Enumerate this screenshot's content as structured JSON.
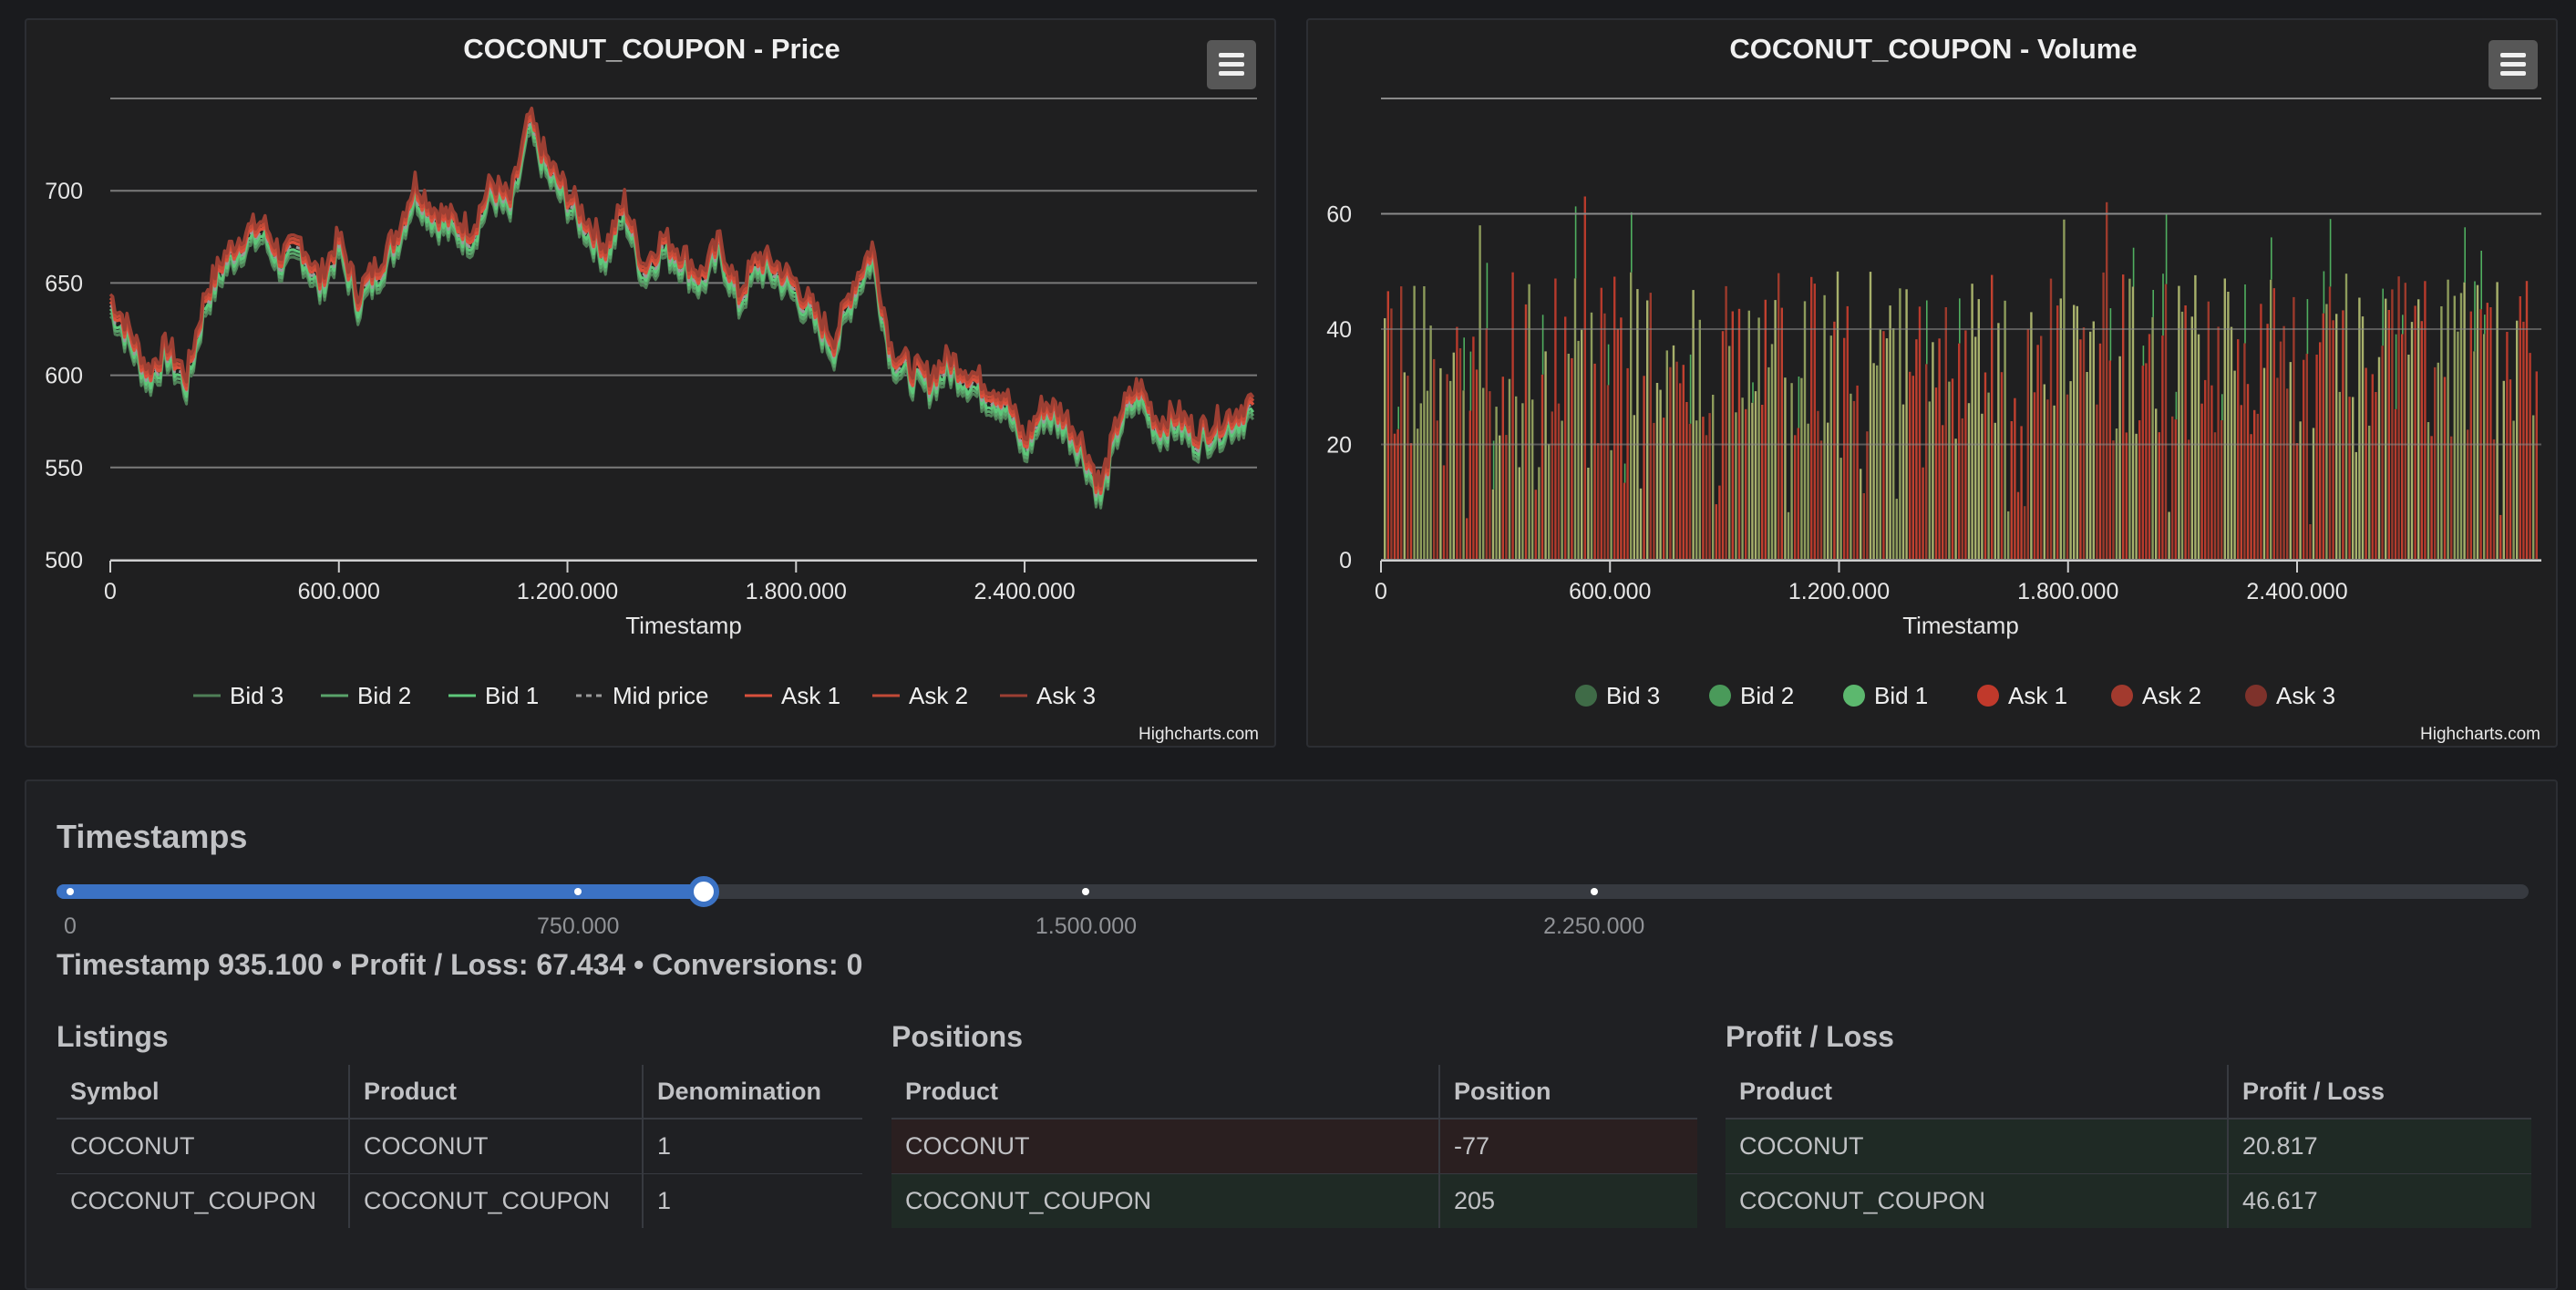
{
  "price_chart": {
    "title": "COCONUT_COUPON - Price",
    "xlabel": "Timestamp",
    "credits": "Highcharts.com",
    "legend": [
      {
        "name": "Bid 3",
        "color": "#4f7f57",
        "style": "solid"
      },
      {
        "name": "Bid 2",
        "color": "#5aa36a",
        "style": "solid"
      },
      {
        "name": "Bid 1",
        "color": "#5ec77a",
        "style": "solid"
      },
      {
        "name": "Mid price",
        "color": "#9a9a9a",
        "style": "dash"
      },
      {
        "name": "Ask 1",
        "color": "#d9503c",
        "style": "solid"
      },
      {
        "name": "Ask 2",
        "color": "#c24a37",
        "style": "solid"
      },
      {
        "name": "Ask 3",
        "color": "#9c3f33",
        "style": "solid"
      }
    ]
  },
  "volume_chart": {
    "title": "COCONUT_COUPON - Volume",
    "xlabel": "Timestamp",
    "credits": "Highcharts.com",
    "legend": [
      {
        "name": "Bid 3",
        "color": "#3f6b47"
      },
      {
        "name": "Bid 2",
        "color": "#4a9a5a"
      },
      {
        "name": "Bid 1",
        "color": "#5cb86e"
      },
      {
        "name": "Ask 1",
        "color": "#c0392b"
      },
      {
        "name": "Ask 2",
        "color": "#a23a2e"
      },
      {
        "name": "Ask 3",
        "color": "#7e322b"
      }
    ]
  },
  "chart_data": [
    {
      "type": "line",
      "title": "COCONUT_COUPON - Price",
      "xlabel": "Timestamp",
      "ylabel": "",
      "xlim": [
        0,
        3000000
      ],
      "ylim": [
        500,
        750
      ],
      "xticks": [
        0,
        600000,
        1200000,
        1800000,
        2400000
      ],
      "xtick_labels": [
        "0",
        "600.000",
        "1.200.000",
        "1.800.000",
        "2.400.000"
      ],
      "yticks": [
        500,
        550,
        600,
        650,
        700
      ],
      "grid": true,
      "legend_position": "bottom",
      "series_names": [
        "Bid 3",
        "Bid 2",
        "Bid 1",
        "Mid price",
        "Ask 1",
        "Ask 2",
        "Ask 3"
      ],
      "x": [
        0,
        50000,
        100000,
        150000,
        200000,
        250000,
        300000,
        350000,
        400000,
        450000,
        500000,
        550000,
        600000,
        650000,
        700000,
        750000,
        800000,
        850000,
        900000,
        950000,
        1000000,
        1050000,
        1100000,
        1150000,
        1200000,
        1250000,
        1300000,
        1350000,
        1400000,
        1450000,
        1500000,
        1550000,
        1600000,
        1650000,
        1700000,
        1750000,
        1800000,
        1850000,
        1900000,
        1950000,
        2000000,
        2050000,
        2100000,
        2150000,
        2200000,
        2250000,
        2300000,
        2350000,
        2400000,
        2450000,
        2500000,
        2550000,
        2600000,
        2650000,
        2700000,
        2750000,
        2800000,
        2850000,
        2900000,
        2950000,
        3000000
      ],
      "mid_price": [
        638,
        620,
        598,
        612,
        595,
        640,
        660,
        672,
        678,
        660,
        668,
        648,
        670,
        640,
        655,
        672,
        700,
        685,
        680,
        675,
        700,
        690,
        735,
        710,
        695,
        680,
        665,
        690,
        655,
        670,
        662,
        650,
        668,
        640,
        660,
        655,
        645,
        630,
        615,
        645,
        665,
        610,
        600,
        595,
        605,
        598,
        590,
        585,
        560,
        580,
        575,
        560,
        535,
        575,
        590,
        570,
        575,
        565,
        570,
        575,
        582
      ]
    },
    {
      "type": "bar",
      "title": "COCONUT_COUPON - Volume",
      "xlabel": "Timestamp",
      "ylabel": "",
      "xlim": [
        0,
        3000000
      ],
      "ylim": [
        0,
        80
      ],
      "xticks": [
        0,
        600000,
        1200000,
        1800000,
        2400000
      ],
      "xtick_labels": [
        "0",
        "600.000",
        "1.200.000",
        "1.800.000",
        "2.400.000"
      ],
      "yticks": [
        0,
        20,
        40,
        60
      ],
      "grid": true,
      "legend_position": "bottom",
      "series_names": [
        "Bid 3",
        "Bid 2",
        "Bid 1",
        "Ask 1",
        "Ask 2",
        "Ask 3"
      ],
      "typical_range": [
        20,
        50
      ],
      "peaks": [
        {
          "x": 260000,
          "y": 58
        },
        {
          "x": 530000,
          "y": 63
        },
        {
          "x": 1790000,
          "y": 59
        },
        {
          "x": 1900000,
          "y": 62
        }
      ]
    }
  ],
  "timestamps": {
    "title": "Timestamps",
    "slider_value": 935100,
    "slider_min": 0,
    "slider_max": 3630000,
    "marks": [
      {
        "label": "0",
        "value": 0
      },
      {
        "label": "750.000",
        "value": 750000
      },
      {
        "label": "1.500.000",
        "value": 1500000
      },
      {
        "label": "2.250.000",
        "value": 2250000
      }
    ],
    "status": "Timestamp 935.100 • Profit / Loss: 67.434 • Conversions: 0"
  },
  "listings": {
    "title": "Listings",
    "headers": [
      "Symbol",
      "Product",
      "Denomination"
    ],
    "rows": [
      [
        "COCONUT",
        "COCONUT",
        "1"
      ],
      [
        "COCONUT_COUPON",
        "COCONUT_COUPON",
        "1"
      ]
    ]
  },
  "positions": {
    "title": "Positions",
    "headers": [
      "Product",
      "Position"
    ],
    "rows": [
      [
        "COCONUT",
        "-77"
      ],
      [
        "COCONUT_COUPON",
        "205"
      ]
    ]
  },
  "profit_loss": {
    "title": "Profit / Loss",
    "headers": [
      "Product",
      "Profit / Loss"
    ],
    "rows": [
      [
        "COCONUT",
        "20.817"
      ],
      [
        "COCONUT_COUPON",
        "46.617"
      ]
    ]
  }
}
